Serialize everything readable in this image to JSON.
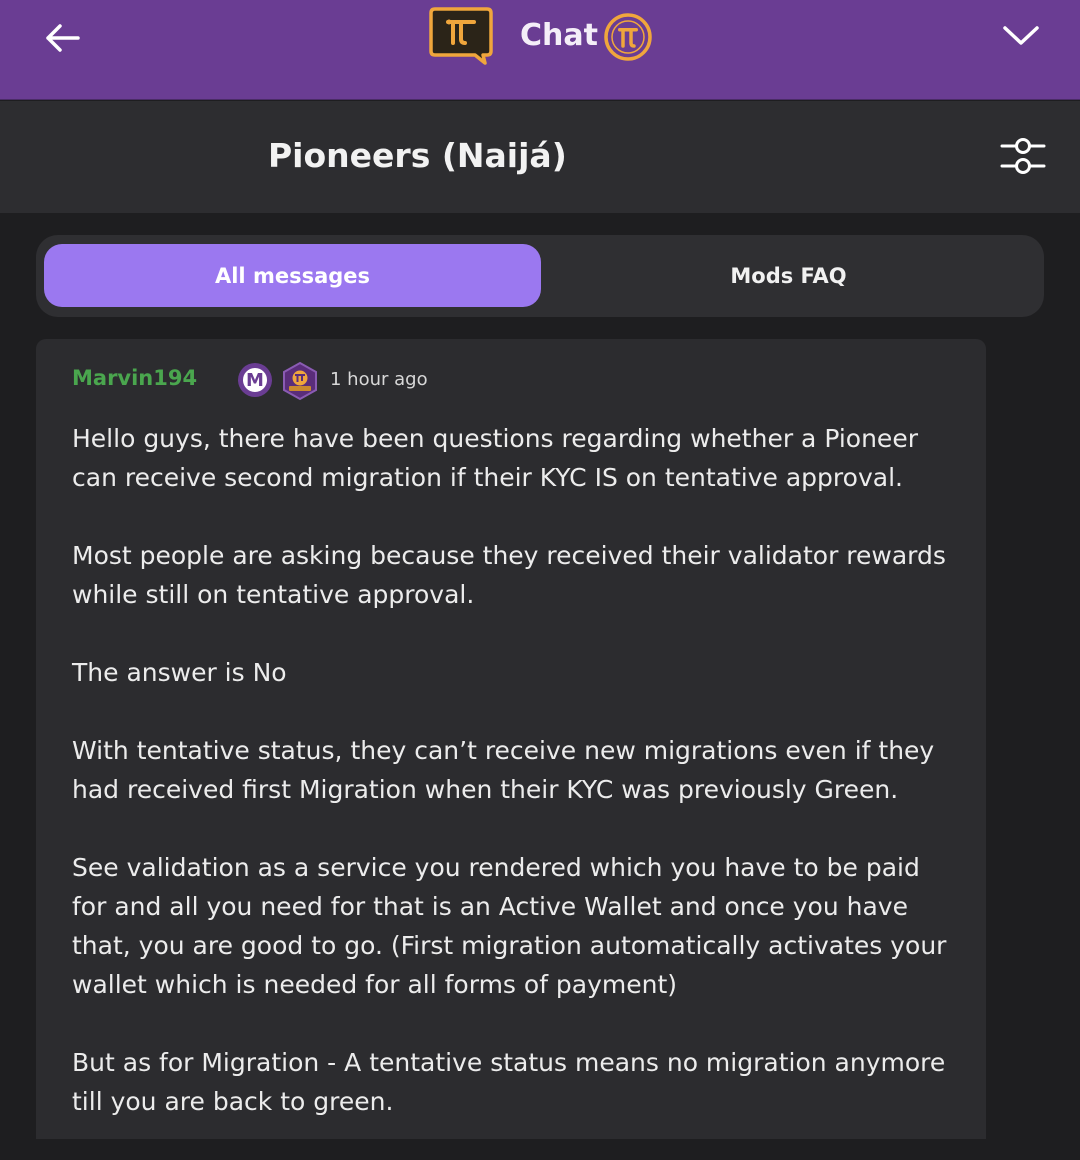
{
  "header": {
    "title": "Chat",
    "back_icon": "arrow-left-icon",
    "logo_icon": "pi-chat-bubble-icon",
    "coin_icon": "pi-coin-icon",
    "menu_icon": "chevron-down-icon",
    "background_color": "#6a3d93",
    "accent_color": "#f0a63c"
  },
  "room": {
    "title": "Pioneers (Naijá)",
    "settings_icon": "sliders-icon"
  },
  "tabs": [
    {
      "label": "All messages",
      "active": true
    },
    {
      "label": "Mods FAQ",
      "active": false
    }
  ],
  "message": {
    "username": "Marvin194",
    "username_color": "#4aa64e",
    "badge_letter": "M",
    "badge_icons": [
      "moderator-badge-icon",
      "pi-hexagon-badge-icon"
    ],
    "time": "1 hour ago",
    "paragraphs": [
      "Hello guys, there have been questions regarding whether a Pioneer can receive second migration if their KYC IS on tentative approval.",
      "Most people are asking because they received their validator rewards while still on tentative approval.",
      "The answer is No",
      "With tentative status, they can’t receive new migrations even if they had received first Migration when their KYC was previously Green.",
      "See validation as a service you rendered which you have to be paid for and all you need for that is an Active Wallet and once you have that, you are good to go. (First migration automatically activates your wallet which is needed for all forms of payment)",
      "But as for Migration - A tentative status means no migration anymore till you are back to green."
    ]
  }
}
